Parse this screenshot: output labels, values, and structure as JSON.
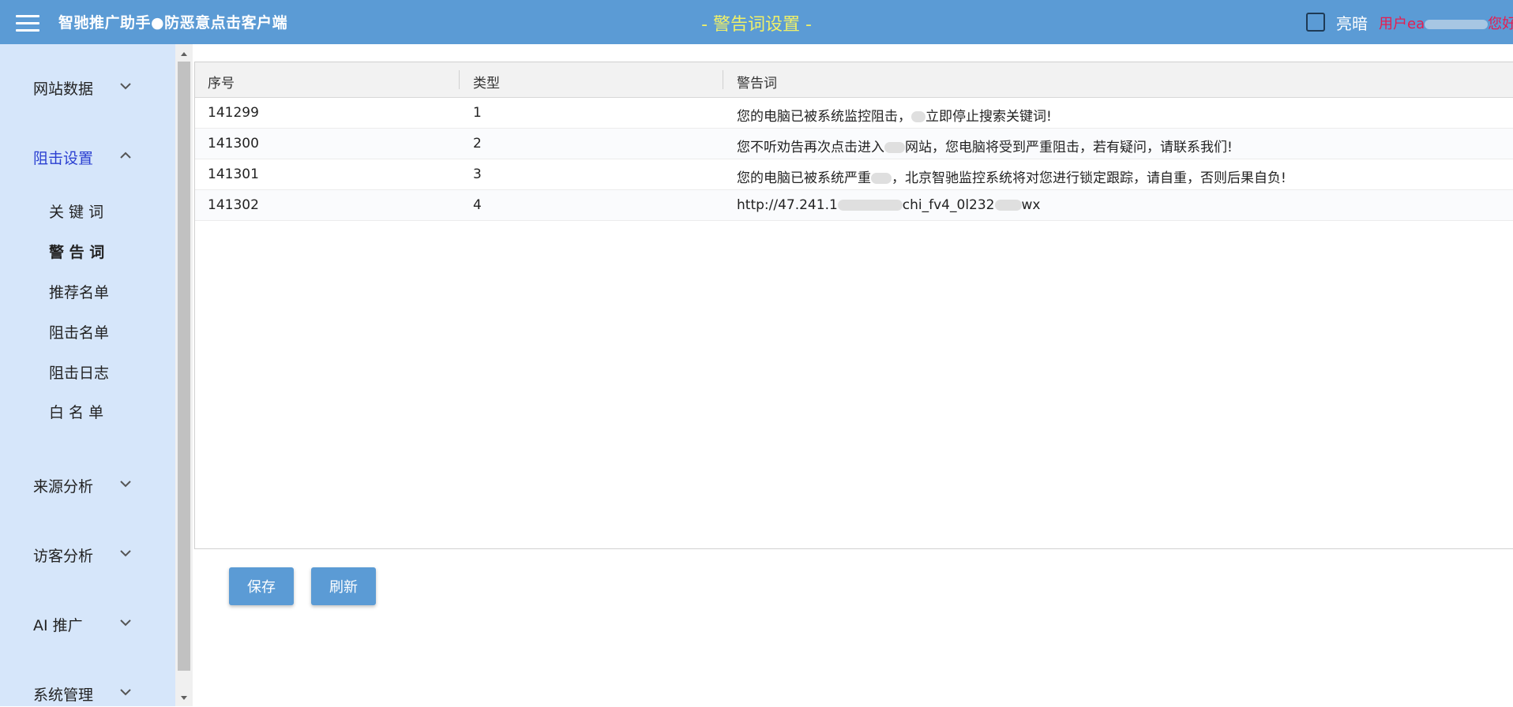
{
  "header": {
    "app_title": "智驰推广助手●防恶意点击客户端",
    "page_title": "- 警告词设置 -",
    "theme_label": "亮暗",
    "greeting_prefix": "用户ea",
    "greeting_suffix": "您好",
    "accent_color": "#5b9bd5"
  },
  "sidebar": {
    "groups": [
      {
        "label": "网站数据"
      },
      {
        "label": "阻击设置"
      },
      {
        "label": "来源分析"
      },
      {
        "label": "访客分析"
      },
      {
        "label": "AI 推广"
      },
      {
        "label": "系统管理"
      }
    ],
    "sub_items": [
      {
        "label": "关 键 词"
      },
      {
        "label": "警 告 词"
      },
      {
        "label": "推荐名单"
      },
      {
        "label": "阻击名单"
      },
      {
        "label": "阻击日志"
      },
      {
        "label": "白 名 单"
      }
    ]
  },
  "table": {
    "columns": [
      "序号",
      "类型",
      "警告词"
    ],
    "rows": [
      {
        "id": "141299",
        "type": "1",
        "text_a": "您的电脑已被系统监控阻击，",
        "text_b": "立即停止搜索关键词!"
      },
      {
        "id": "141300",
        "type": "2",
        "text_a": "您不听劝告再次点击进入",
        "text_b": "网站，您电脑将受到严重阻击，若有疑问，请联系我们!"
      },
      {
        "id": "141301",
        "type": "3",
        "text_a": "您的电脑已被系统严重",
        "text_b": "，北京智驰监控系统将对您进行锁定跟踪，请自重，否则后果自负!"
      },
      {
        "id": "141302",
        "type": "4",
        "text_a": "http://47.241.1",
        "text_b": "chi_fv4_0l232",
        "text_c": "wx"
      }
    ]
  },
  "buttons": {
    "save": "保存",
    "refresh": "刷新"
  }
}
